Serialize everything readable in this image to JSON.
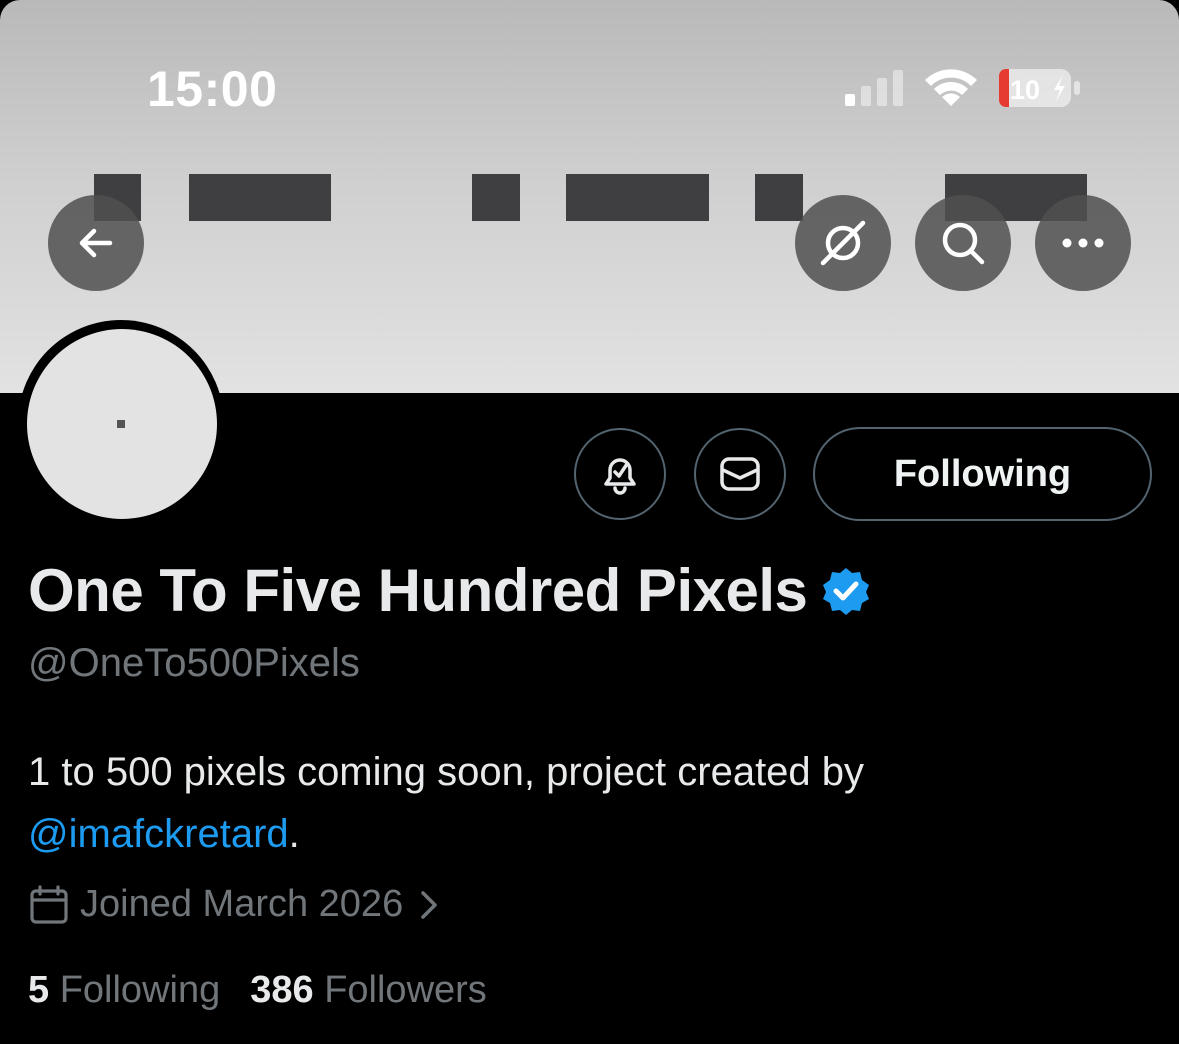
{
  "status_bar": {
    "time": "15:00",
    "battery_level": "10"
  },
  "header": {
    "back_icon": "arrow-left-icon",
    "grok_icon": "grok-icon",
    "search_icon": "search-icon",
    "more_icon": "more-icon"
  },
  "profile": {
    "display_name": "One To Five Hundred Pixels",
    "handle": "@OneTo500Pixels",
    "bio_text": "1 to 500 pixels coming soon, project created by ",
    "bio_mention": "@imafckretard",
    "bio_end": ".",
    "joined": "Joined March 2026",
    "following_count": "5",
    "following_label": "Following",
    "followers_count": "386",
    "followers_label": "Followers",
    "verified": true
  },
  "actions": {
    "notify_icon": "bell-check-icon",
    "message_icon": "envelope-icon",
    "follow_button_label": "Following"
  },
  "colors": {
    "accent": "#1d9bf0",
    "background": "#000000",
    "muted_text": "#71767b",
    "verified_badge": "#1d9bf0"
  }
}
